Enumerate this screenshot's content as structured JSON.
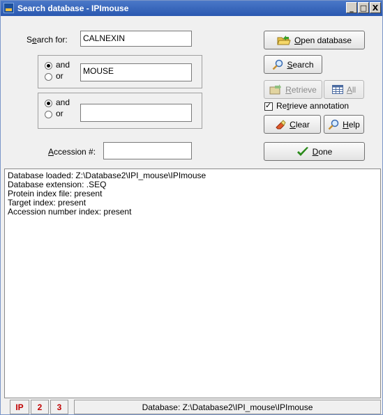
{
  "window": {
    "title": "Search database - IPImouse",
    "controls": [
      "_",
      "□",
      "X"
    ]
  },
  "search": {
    "search_for_label_pre": "S",
    "search_for_label_ul": "e",
    "search_for_label_post": "arch for:",
    "search_for_value": "CALNEXIN",
    "group1": {
      "and_label": "and",
      "or_label": "or",
      "selected": "and",
      "value": "MOUSE"
    },
    "group2": {
      "and_label": "and",
      "or_label": "or",
      "selected": "and",
      "value": ""
    },
    "accession_label_ul": "A",
    "accession_label_post": "ccession #:",
    "accession_value": ""
  },
  "buttons": {
    "open_ul": "O",
    "open_post": "pen database",
    "search_ul": "S",
    "search_post": "earch",
    "retrieve_ul": "R",
    "retrieve_post": "etrieve",
    "all_ul": "A",
    "all_post": "ll",
    "retrieve_annotation_pre": "Re",
    "retrieve_annotation_ul": "t",
    "retrieve_annotation_post": "rieve annotation",
    "retrieve_annotation_checked": true,
    "clear_ul": "C",
    "clear_post": "lear",
    "help_ul": "H",
    "help_post": "elp",
    "done_ul": "D",
    "done_post": "one"
  },
  "output": {
    "lines": [
      "Database loaded: Z:\\Database2\\IPI_mouse\\IPImouse",
      "Database extension: .SEQ",
      "Protein index file:  present",
      "Target index:  present",
      "Accession number index:  present"
    ]
  },
  "statusbar": {
    "tabs": [
      "IP",
      "2",
      "3"
    ],
    "database_text": "Database: Z:\\Database2\\IPI_mouse\\IPImouse"
  },
  "colors": {
    "titlebar": "#2a58b0",
    "tab_text": "#c00000",
    "done_check": "#2a8a1a"
  }
}
